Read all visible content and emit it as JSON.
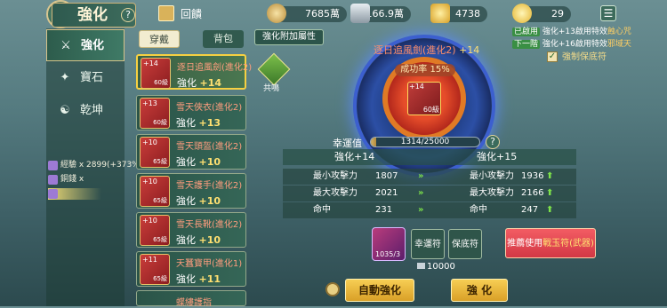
{
  "header": {
    "title": "強化",
    "gift_label": "回饋",
    "currencies": [
      {
        "name": "coin",
        "value": "7685萬"
      },
      {
        "name": "silver-ingot",
        "value": "166.9萬"
      },
      {
        "name": "gold-ingot",
        "value": "4738"
      },
      {
        "name": "yuanbao",
        "value": "29"
      }
    ]
  },
  "sidebar": {
    "items": [
      {
        "label": "強化",
        "active": true
      },
      {
        "label": "寶石"
      },
      {
        "label": "乾坤"
      }
    ],
    "resources": [
      "經驗 x 2899(+373%)",
      "銅錢 x",
      ""
    ]
  },
  "tabs": {
    "equip": "穿戴",
    "bag": "背包"
  },
  "equipment": [
    {
      "name": "逐日追風劍(進化2)",
      "level": "強化",
      "bonus": "+14",
      "plus": "+14",
      "lv": "60級"
    },
    {
      "name": "雪天俠衣(進化2)",
      "level": "強化",
      "bonus": "+13",
      "plus": "+13",
      "lv": "60級"
    },
    {
      "name": "雪天頭盔(進化2)",
      "level": "強化",
      "bonus": "+10",
      "plus": "+10",
      "lv": "65級"
    },
    {
      "name": "雪天護手(進化2)",
      "level": "強化",
      "bonus": "+10",
      "plus": "+10",
      "lv": "65級"
    },
    {
      "name": "雪天長靴(進化2)",
      "level": "強化",
      "bonus": "+10",
      "plus": "+10",
      "lv": "65級"
    },
    {
      "name": "天蠶寶甲(進化1)",
      "level": "強化",
      "bonus": "+11",
      "plus": "+11",
      "lv": "65級"
    },
    {
      "name": "蝶縷護指",
      "level": "",
      "bonus": "",
      "plus": "",
      "lv": ""
    }
  ],
  "attr_button": "強化附加屬性",
  "resonance_label": "共鳴",
  "wheel": {
    "item_name": "逐日追風劍(進化2)",
    "item_plus": "+14",
    "rate": "成功率 15%",
    "item_lv": "60級",
    "plus_tag": "+14"
  },
  "luck": {
    "label": "幸運值",
    "text": "1314/25000",
    "current": 1314,
    "max": 25000
  },
  "compare": {
    "from": "強化+14",
    "to": "強化+15",
    "rows": [
      {
        "label": "最小攻擊力",
        "from": "1807",
        "to": "1936"
      },
      {
        "label": "最大攻擊力",
        "from": "2021",
        "to": "2166"
      },
      {
        "label": "命中",
        "from": "231",
        "to": "247"
      }
    ]
  },
  "right_info": {
    "line1_tag": "已啟用",
    "line1_text": "強化+13啟用特效",
    "line1_hl": "蝕心咒",
    "line2_tag": "下一階",
    "line2_text": "強化+16啟用特效",
    "line2_hl": "邪域天",
    "protect": "強制保底符"
  },
  "bottom": {
    "gem_count": "1035/3",
    "luck_charm": "幸運符",
    "protect_charm": "保底符",
    "recommend_text": "推薦使用",
    "recommend_hl": "戰玉符(武器)",
    "cost": "10000",
    "auto_btn": "自動強化",
    "strengthen_btn": "強 化"
  }
}
